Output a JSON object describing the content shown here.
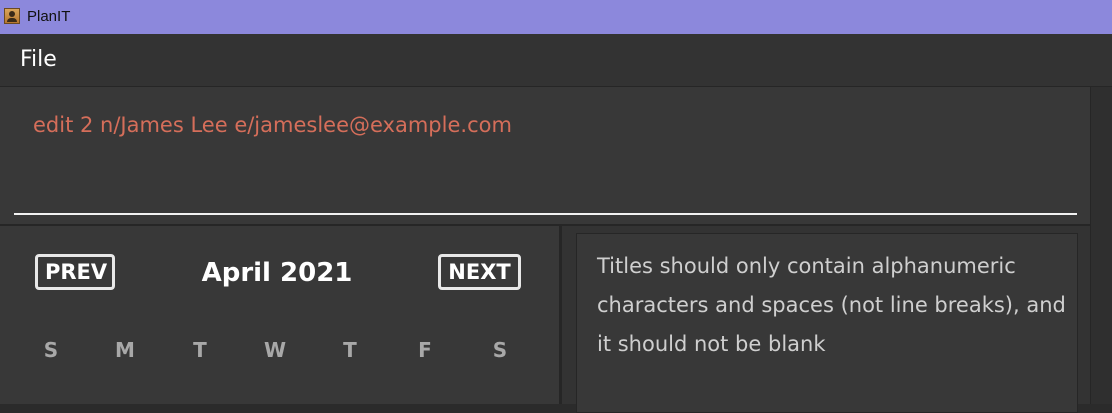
{
  "window": {
    "title": "PlanIT",
    "icon": "address-book-icon"
  },
  "menu": {
    "file_label": "File"
  },
  "command_box": {
    "text": "edit 2 n/James Lee e/jameslee@example.com",
    "text_color": "#d56e5a"
  },
  "calendar": {
    "prev_label": "PREV",
    "next_label": "NEXT",
    "month_label": "April 2021",
    "weekdays": [
      "S",
      "M",
      "T",
      "W",
      "T",
      "F",
      "S"
    ]
  },
  "result_display": {
    "message": "Titles should only contain alphanumeric characters and spaces (not line breaks), and it should not be blank"
  },
  "colors": {
    "titlebar": "#8c88dc",
    "background": "#383838",
    "error_text": "#d56e5a"
  }
}
